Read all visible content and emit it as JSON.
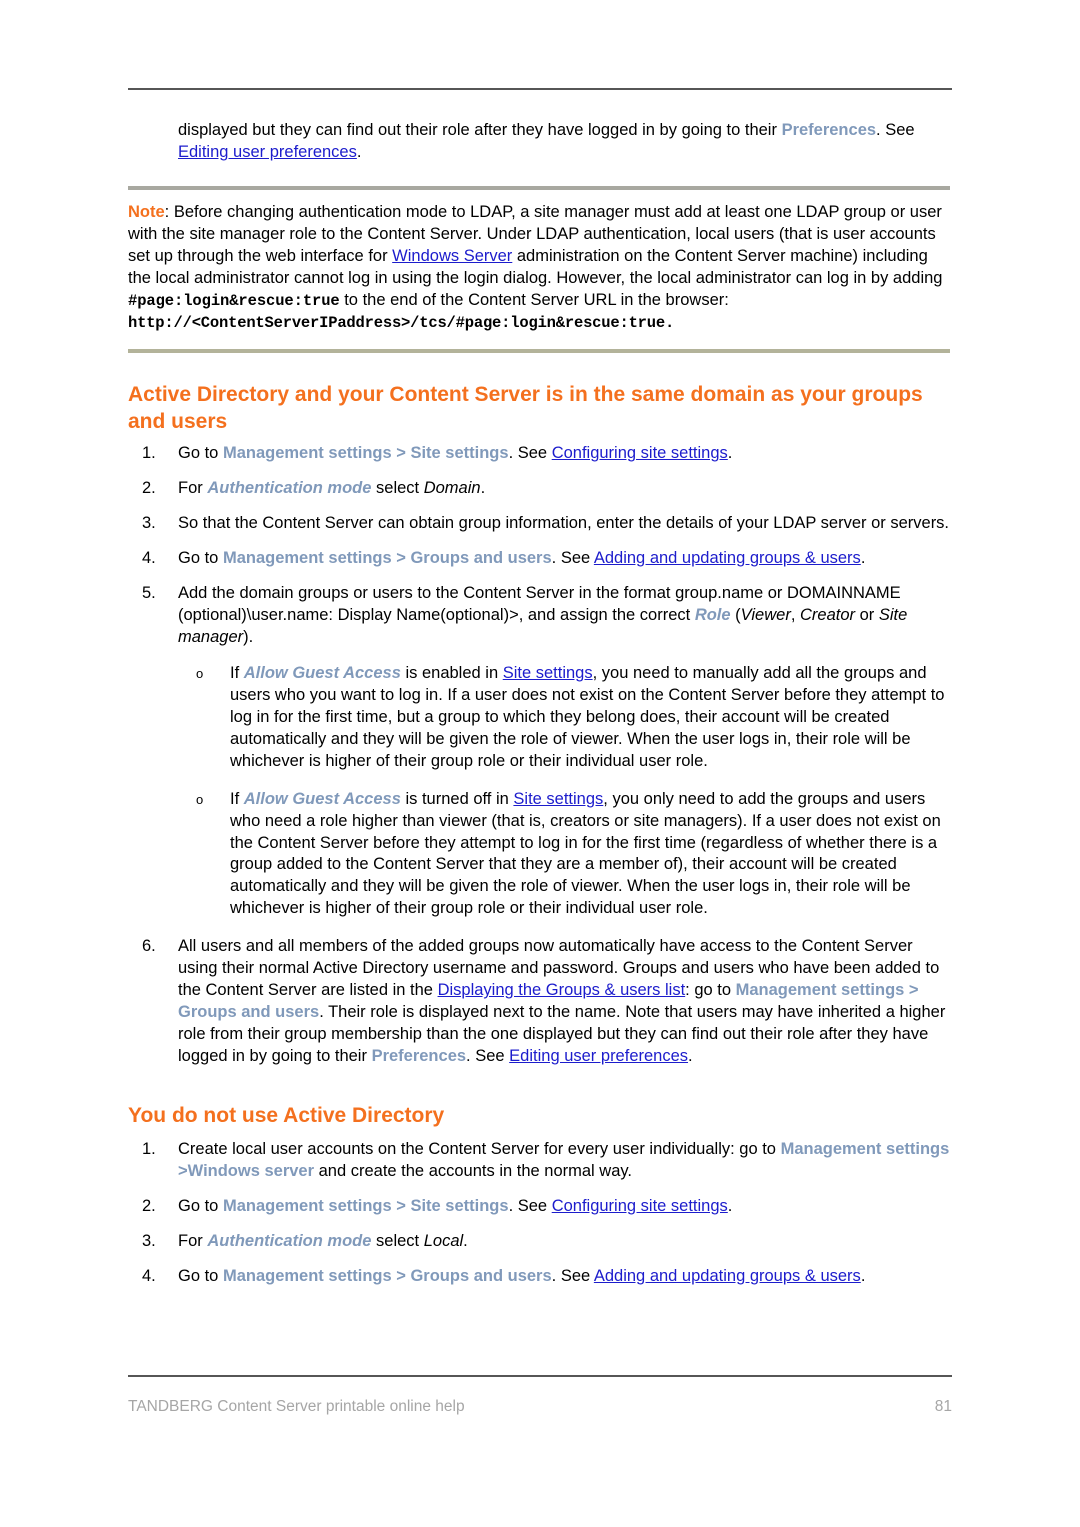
{
  "document": {
    "footer_text": "TANDBERG Content Server printable online help",
    "page_number": "81"
  },
  "colors": {
    "heading_orange": "#f4701e",
    "ui_path_blue_gray": "#8099ba",
    "link_blue": "#1c1ccc",
    "rule_dark": "#565656",
    "note_rule": "#a8a8a0",
    "footer_gray": "#a6a6a6"
  },
  "intro": {
    "part1": "displayed but they can find out their role after they have logged in by going to their ",
    "ui_preferences": "Preferences",
    "part2": ". See ",
    "link_editing_prefs": "Editing user preferences",
    "part3": "."
  },
  "note": {
    "label": "Note",
    "text_before_mono": ": Before changing authentication mode to LDAP, a site manager must add at least one LDAP group or user with the site manager role to the Content Server. Under LDAP authentication, local users (that is user accounts set up through the web interface for ",
    "link_windows_server": "Windows Server",
    "text_middle": " administration on the Content Server machine) including the local administrator cannot log in using the login dialog. However, the local administrator can log in by adding ",
    "mono_fragment": "#page:login&rescue:true",
    "text_after_mono": " to the end of the Content Server URL in the browser:",
    "url": "http://<ContentServerIPaddress>/tcs/#page:login&rescue:true."
  },
  "section1": {
    "heading": "Active Directory and your Content Server is in the same domain as your groups and users",
    "steps": [
      {
        "num": "1.",
        "before": "Go to ",
        "ui": "Management settings > Site settings",
        "mid": ". See ",
        "link": "Configuring site settings",
        "after": "."
      },
      {
        "num": "2.",
        "before": "For ",
        "ui_it": "Authentication mode",
        "mid": " select ",
        "italic": "Domain",
        "after": "."
      },
      {
        "num": "3.",
        "plain": "So that the Content Server can obtain group information, enter the details of your LDAP server or servers."
      },
      {
        "num": "4.",
        "before": "Go to ",
        "ui": "Management settings > Groups and users",
        "mid": ". See ",
        "link": "Adding and updating groups & users",
        "after": "."
      },
      {
        "num": "5.",
        "p_before": "Add the domain groups or users to the Content Server in the format group.name or DOMAINNAME (optional)\\user.name: Display Name(optional)>, and assign the correct ",
        "ui_role": "Role",
        "p_mid": " (",
        "it_viewer": "Viewer",
        "sep1": ", ",
        "it_creator": "Creator",
        "sep2": " or ",
        "it_sitemanager": "Site manager",
        "p_after": ")."
      },
      {
        "num": "6.",
        "before": "All users and all members of the added groups now automatically have access to the Content Server using their normal Active Directory username and password. Groups and users who have been added to the Content Server are listed in the ",
        "link1": "Displaying the Groups & users list",
        "mid1": ": go to ",
        "ui1": "Management settings > Groups and users",
        "mid2": ". Their role is displayed next to the name. Note that users may have inherited a higher role from their group membership than the one displayed but they can find out their role after they have logged in by going to their ",
        "ui2": "Preferences",
        "mid3": ". See ",
        "link2": "Editing user preferences",
        "after": "."
      }
    ],
    "substeps": [
      {
        "bullet": "o",
        "before": "If ",
        "ui_it": "Allow Guest Access",
        "mid1": " is enabled in ",
        "link": "Site settings",
        "after": ", you need to manually add all the groups and users who you want to log in.  If a user does not exist on the Content Server before they attempt to log in for the first time, but a group to which they belong does, their account will be created automatically and they will be given the role of viewer. When the user logs in, their role will be whichever is higher of their group role or their individual user role."
      },
      {
        "bullet": "o",
        "before": "If ",
        "ui_it": "Allow Guest Access",
        "mid1": " is turned off in ",
        "link": "Site settings",
        "after": ", you only need to add the groups and users who need a role higher than viewer (that is, creators or site managers). If a user does not exist on the Content Server before they attempt to log in for the first time (regardless of whether there is a group added to the Content Server that they are a member of), their account will be created automatically and they will be given the role of viewer. When the user logs in, their role will be whichever is higher of their group role or their individual user role."
      }
    ]
  },
  "section2": {
    "heading": "You do not use Active Directory",
    "steps": [
      {
        "num": "1.",
        "before": "Create local user accounts on the Content Server for every user individually: go to ",
        "ui": "Management settings >Windows server",
        "after": " and create the accounts in the normal way."
      },
      {
        "num": "2.",
        "before": "Go to ",
        "ui": "Management settings > Site settings",
        "mid": ". See ",
        "link": "Configuring site settings",
        "after": "."
      },
      {
        "num": "3.",
        "before": "For ",
        "ui_it": "Authentication mode",
        "mid": " select ",
        "italic": "Local",
        "after": "."
      },
      {
        "num": "4.",
        "before": "Go to ",
        "ui": "Management settings > Groups and users",
        "mid": ". See ",
        "link": "Adding and updating groups & users",
        "after": "."
      }
    ]
  }
}
